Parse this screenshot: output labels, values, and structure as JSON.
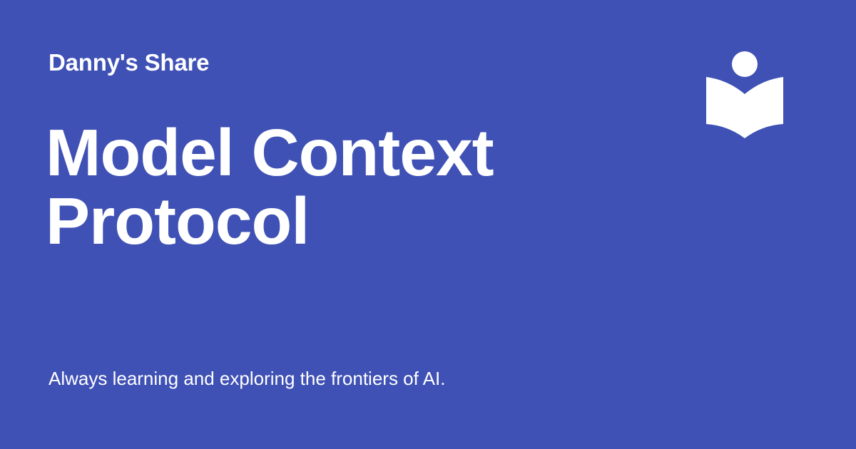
{
  "card": {
    "site_name": "Danny's Share",
    "title": "Model Context Protocol",
    "tagline": "Always learning and exploring the frontiers of AI.",
    "logo_icon": "reader-book-icon"
  },
  "colors": {
    "background": "#3f51b5",
    "text": "#ffffff"
  }
}
